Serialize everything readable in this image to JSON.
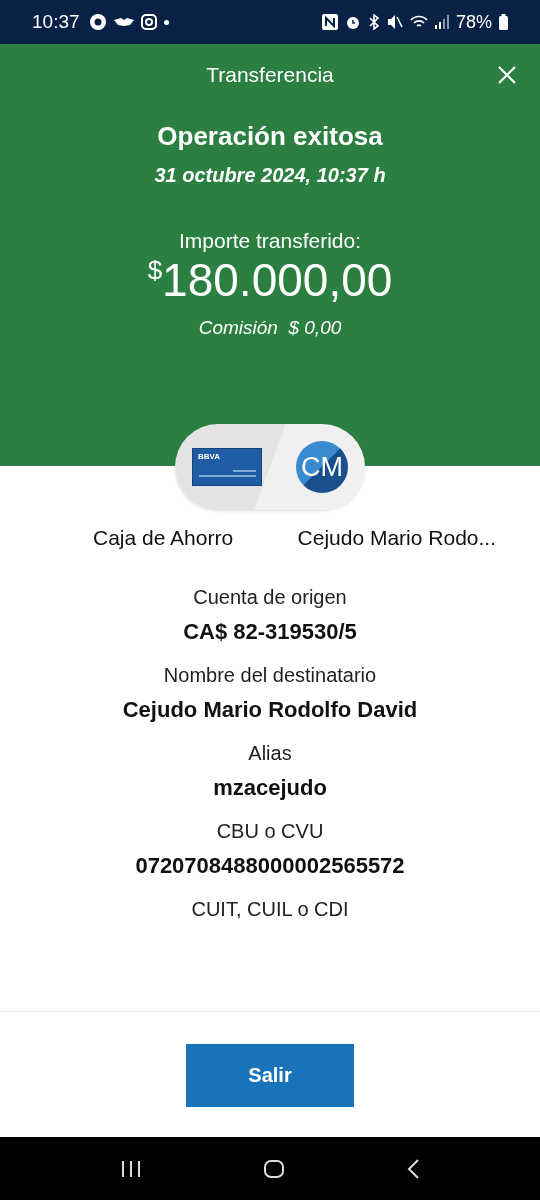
{
  "status_bar": {
    "time": "10:37",
    "battery": "78%"
  },
  "header": {
    "title": "Transferencia"
  },
  "result": {
    "title": "Operación exitosa",
    "date": "31 octubre 2024, 10:37 h",
    "amount_label": "Importe transferido:",
    "currency": "$",
    "amount": "180.000,00",
    "commission": "Comisión  $ 0,00"
  },
  "accounts": {
    "card_brand": "BBVA",
    "initials": "CM",
    "from": "Caja de Ahorro",
    "to": "Cejudo Mario Rodo..."
  },
  "details": [
    {
      "label": "Cuenta de origen",
      "value": "CA$ 82-319530/5"
    },
    {
      "label": "Nombre del destinatario",
      "value": "Cejudo Mario Rodolfo David"
    },
    {
      "label": "Alias",
      "value": "mzacejudo"
    },
    {
      "label": "CBU o CVU",
      "value": "0720708488000002565572"
    },
    {
      "label": "CUIT, CUIL o CDI"
    }
  ],
  "button": "Salir"
}
